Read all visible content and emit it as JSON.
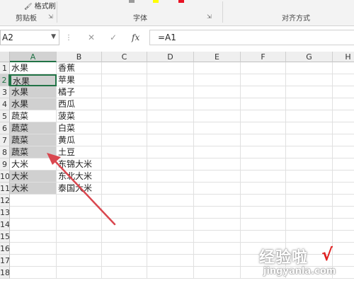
{
  "ribbon": {
    "format_painter_label": "格式刷",
    "groups": [
      {
        "name": "clipboard",
        "label": "剪贴板"
      },
      {
        "name": "font",
        "label": "字体"
      },
      {
        "name": "alignment",
        "label": "对齐方式"
      }
    ],
    "font_color_swatch": "#e81123",
    "highlight_color_swatch": "#ffff00"
  },
  "formula_bar": {
    "name_box_value": "A2",
    "formula_value": "=A1",
    "fx_label": "fx",
    "cancel_glyph": "✕",
    "enter_glyph": "✓"
  },
  "sheet": {
    "columns": [
      "A",
      "B",
      "C",
      "D",
      "E",
      "F",
      "G",
      "H"
    ],
    "selected_column": "A",
    "row_numbers": [
      "1",
      "2",
      "3",
      "4",
      "5",
      "6",
      "7",
      "8",
      "9",
      "10",
      "11",
      "12",
      "13",
      "14",
      "15",
      "16",
      "17",
      "18"
    ],
    "active_cell": "A2",
    "accent_color": "#217346",
    "shade_color": "#d0d0d0",
    "rows": [
      {
        "a": "水果",
        "b": "香蕉"
      },
      {
        "a": "水果",
        "b": "苹果"
      },
      {
        "a": "水果",
        "b": "橘子"
      },
      {
        "a": "水果",
        "b": "西瓜"
      },
      {
        "a": "蔬菜",
        "b": "菠菜"
      },
      {
        "a": "蔬菜",
        "b": "白菜"
      },
      {
        "a": "蔬菜",
        "b": "黄瓜"
      },
      {
        "a": "蔬菜",
        "b": "土豆"
      },
      {
        "a": "大米",
        "b": "东锦大米"
      },
      {
        "a": "大米",
        "b": "东北大米"
      },
      {
        "a": "大米",
        "b": "泰国大米"
      }
    ],
    "shaded_rows_col_a": [
      "2",
      "3",
      "4",
      "6",
      "7",
      "8",
      "10",
      "11"
    ]
  },
  "annotation": {
    "color": "#d9474f"
  },
  "watermark": {
    "line1": "经验啦",
    "mark": "√",
    "line2": "jingyanla.com"
  }
}
